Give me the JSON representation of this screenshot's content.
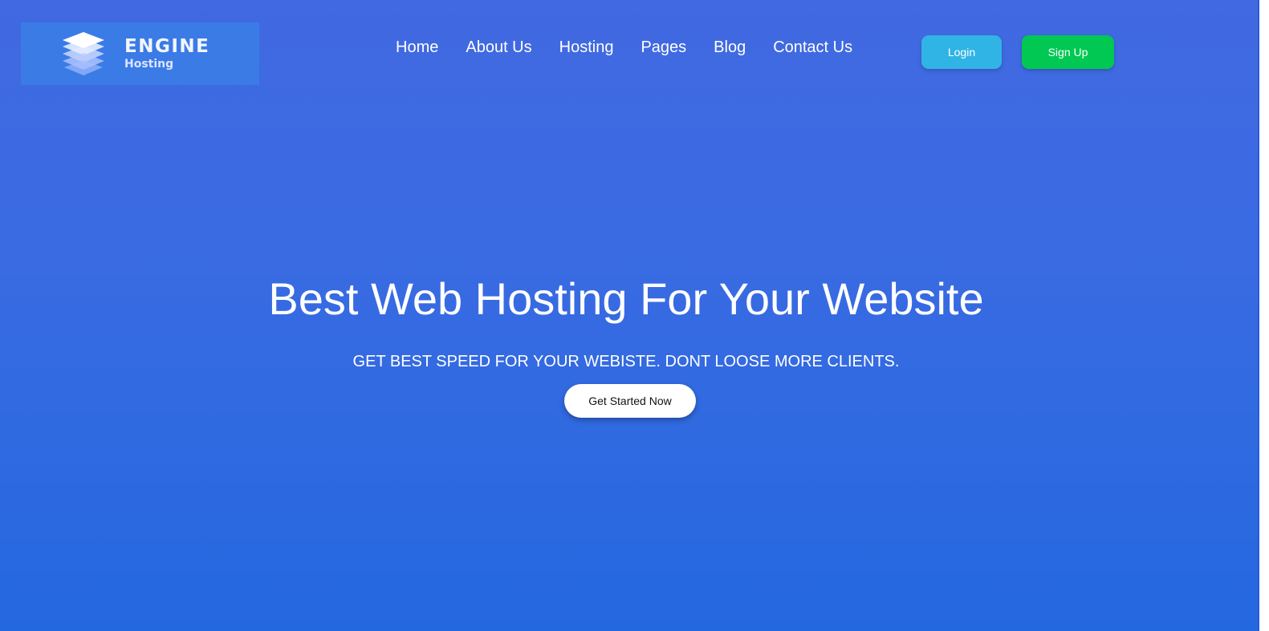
{
  "brand": {
    "name": "ENGINE",
    "subtitle": "Hosting",
    "logo_icon": "stacked-layers-icon"
  },
  "nav": {
    "items": [
      {
        "label": "Home"
      },
      {
        "label": "About Us"
      },
      {
        "label": "Hosting"
      },
      {
        "label": "Pages"
      },
      {
        "label": "Blog"
      },
      {
        "label": "Contact Us"
      }
    ]
  },
  "auth": {
    "login_label": "Login",
    "signup_label": "Sign Up"
  },
  "hero": {
    "title": "Best Web Hosting For Your Website",
    "subtitle": "GET BEST SPEED FOR YOUR WEBISTE. DONT LOOSE MORE CLIENTS.",
    "cta_label": "Get Started Now"
  },
  "colors": {
    "background_top": "#4169e1",
    "background_bottom": "#2468e0",
    "login_button": "#30b4e6",
    "signup_button": "#00c853",
    "cta_button": "#ffffff"
  }
}
